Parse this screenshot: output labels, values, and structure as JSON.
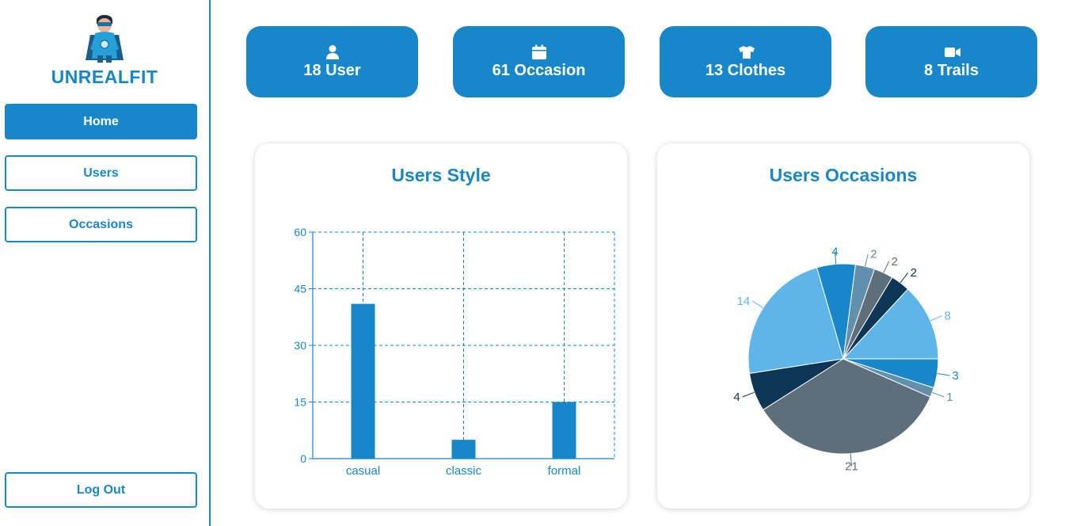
{
  "brand": {
    "name": "UNREALFIT"
  },
  "nav": {
    "home": "Home",
    "users": "Users",
    "occasions": "Occasions",
    "logout": "Log Out"
  },
  "stats": [
    {
      "label": "18 User",
      "icon": "user-icon"
    },
    {
      "label": "61 Occasion",
      "icon": "calendar-icon"
    },
    {
      "label": "13 Clothes",
      "icon": "shirt-icon"
    },
    {
      "label": "8 Trails",
      "icon": "video-icon"
    }
  ],
  "colors": {
    "accent": "#1787c9"
  },
  "chart_data": [
    {
      "type": "bar",
      "title": "Users Style",
      "categories": [
        "casual",
        "classic",
        "formal"
      ],
      "values": [
        41,
        5,
        15
      ],
      "ylim": [
        0,
        60
      ],
      "yticks": [
        0,
        15,
        30,
        45,
        60
      ],
      "grid": true,
      "color": "#1787c9"
    },
    {
      "type": "pie",
      "title": "Users Occasions",
      "values": [
        8,
        2,
        2,
        2,
        4,
        14,
        4,
        21,
        1,
        3
      ],
      "colors": [
        "#5eb5e9",
        "#0d3556",
        "#5e6e7b",
        "#6090ab",
        "#1787c9",
        "#5eb5e9",
        "#0d3556",
        "#5e6e7b",
        "#6090ab",
        "#1787c9"
      ],
      "label_colors": [
        "#5eb5e9",
        "#0d3556",
        "#5e6e7b",
        "#6090ab",
        "#1787c9",
        "#5eb5e9",
        "#0d3556",
        "#5e6e7b",
        "#6090ab",
        "#1787c9"
      ]
    }
  ]
}
